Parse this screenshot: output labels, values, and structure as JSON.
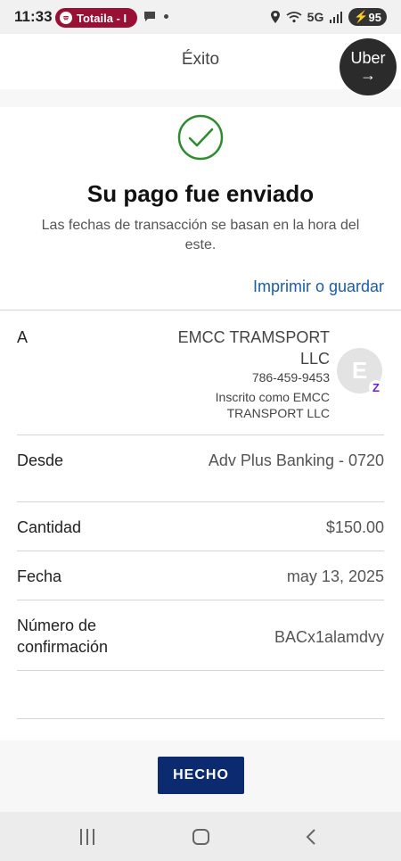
{
  "status_bar": {
    "time": "11:33",
    "media_pill": "Totaila - I",
    "network": "5G",
    "battery": "95"
  },
  "header": {
    "title": "Éxito",
    "uber_label": "Uber",
    "uber_arrow": "→"
  },
  "success": {
    "headline": "Su pago fue enviado",
    "subtext": "Las fechas de transacción se basan en la hora del este.",
    "print_link": "Imprimir o guardar"
  },
  "recipient": {
    "label": "A",
    "name": "EMCC TRAMSPORT LLC",
    "phone": "786-459-9453",
    "registered_as": "Inscrito como EMCC TRANSPORT LLC",
    "avatar_initial": "E",
    "badge": "Z"
  },
  "details": {
    "from_label": "Desde",
    "from_value": "Adv Plus Banking - 0720",
    "amount_label": "Cantidad",
    "amount_value": "$150.00",
    "date_label": "Fecha",
    "date_value": "may 13, 2025",
    "confirmation_label": "Número de confirmación",
    "confirmation_value": "BACx1alamdvy"
  },
  "done_button": "HECHO",
  "colors": {
    "primary_button": "#0c2a6f",
    "link": "#1b5ca8",
    "success_check": "#2e8b2e",
    "pill": "#9a1035"
  }
}
